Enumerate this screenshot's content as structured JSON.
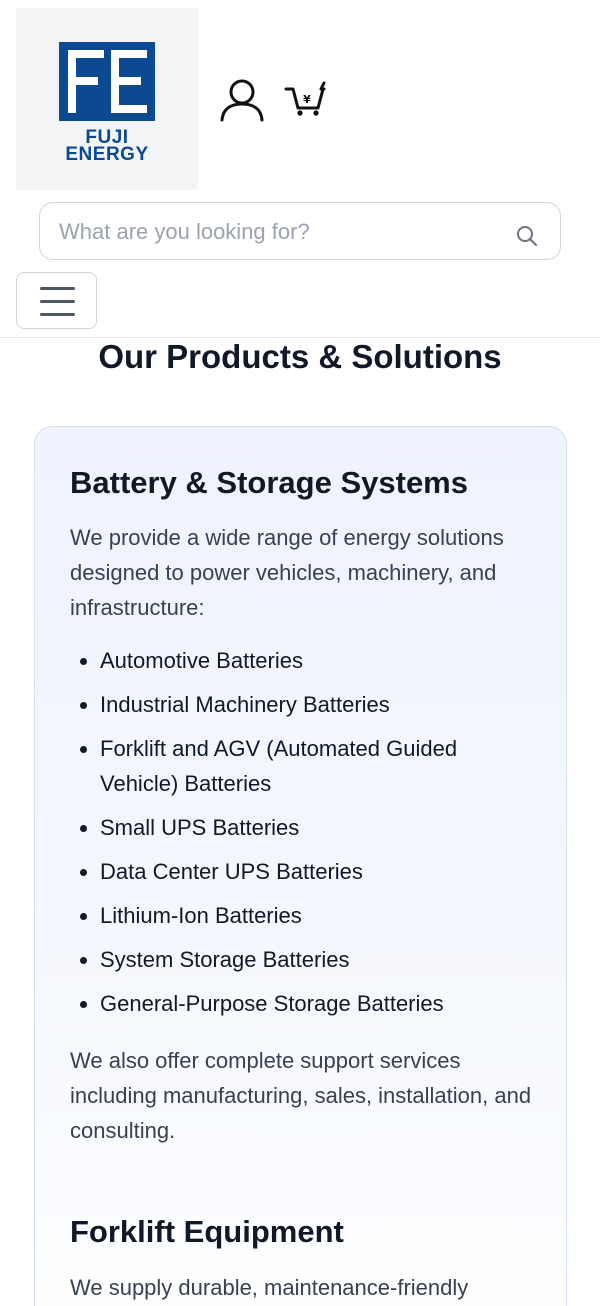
{
  "header": {
    "logo": {
      "mark_text": "FE",
      "brand_line1": "FUJI",
      "brand_line2": "ENERGY",
      "color": "#0b4a93"
    },
    "icons": [
      "user-icon",
      "cart-icon"
    ],
    "cart_symbol": "¥"
  },
  "search": {
    "placeholder": "What are you looking for?"
  },
  "menu": {
    "icon": "hamburger-icon"
  },
  "main": {
    "title": "Our Products & Solutions",
    "card": {
      "heading": "Battery & Storage Systems",
      "intro": "We provide a wide range of energy solutions designed to power vehicles, machinery, and infrastructure:",
      "items": [
        "Automotive Batteries",
        "Industrial Machinery Batteries",
        "Forklift and AGV (Automated Guided Vehicle) Batteries",
        "Small UPS Batteries",
        "Data Center UPS Batteries",
        "Lithium-Ion Batteries",
        "System Storage Batteries",
        "General-Purpose Storage Batteries"
      ],
      "outro": "We also offer complete support services including manufacturing, sales, installation, and consulting.",
      "heading2": "Forklift Equipment",
      "text2": "We supply durable, maintenance-friendly"
    }
  }
}
